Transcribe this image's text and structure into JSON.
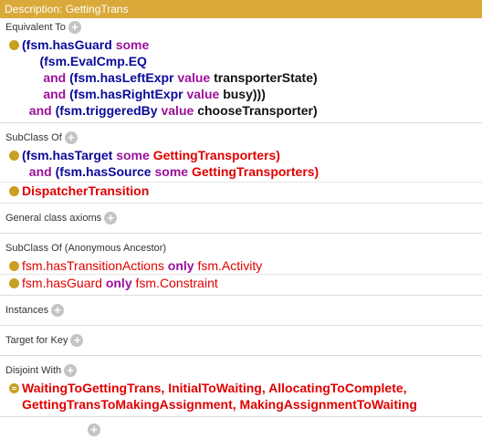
{
  "header": {
    "title": "Description: GettingTrans"
  },
  "sections": {
    "equivalent": {
      "label": "Equivalent To"
    },
    "subclass": {
      "label": "SubClass Of"
    },
    "general": {
      "label": "General class axioms"
    },
    "ancestor": {
      "label": "SubClass Of (Anonymous Ancestor)"
    },
    "instances": {
      "label": "Instances"
    },
    "targetkey": {
      "label": "Target for Key"
    },
    "disjoint": {
      "label": "Disjoint With"
    }
  },
  "equivalent_expr": {
    "open": "(",
    "fsm_hasGuard": "fsm.hasGuard",
    "some": "some",
    "fsm_EvalCmp_EQ": "(fsm.EvalCmp.EQ",
    "and1": "and",
    "fsm_hasLeftExpr": "(fsm.hasLeftExpr",
    "value1": "value",
    "transporterState": "transporterState)",
    "and2": "and",
    "fsm_hasRightExpr": "(fsm.hasRightExpr",
    "value2": "value",
    "busy": "busy)))",
    "and3": "and",
    "fsm_triggeredBy": "(fsm.triggeredBy",
    "value3": "value",
    "chooseTransporter": "chooseTransporter)"
  },
  "subclass_expr": {
    "hasTarget": "(fsm.hasTarget",
    "some1": "some",
    "GettingTransporters1": "GettingTransporters)",
    "and": "and",
    "hasSource": "(fsm.hasSource",
    "some2": "some",
    "GettingTransporters2": "GettingTransporters)",
    "dispatcher": "DispatcherTransition"
  },
  "ancestor_expr": {
    "row1_prop": "fsm.hasTransitionActions",
    "row1_kw": "only",
    "row1_cls": "fsm.Activity",
    "row2_prop": "fsm.hasGuard",
    "row2_kw": "only",
    "row2_cls": "fsm.Constraint"
  },
  "disjoint_expr": {
    "line1": "WaitingToGettingTrans, InitialToWaiting, AllocatingToComplete,",
    "line2": "GettingTransToMakingAssignment, MakingAssignmentToWaiting"
  },
  "colors": {
    "header": "#d9a93a",
    "bullet": "#c9a022",
    "keyword": "#9b119b",
    "class": "#e00000",
    "property": "#0a0a9a"
  }
}
